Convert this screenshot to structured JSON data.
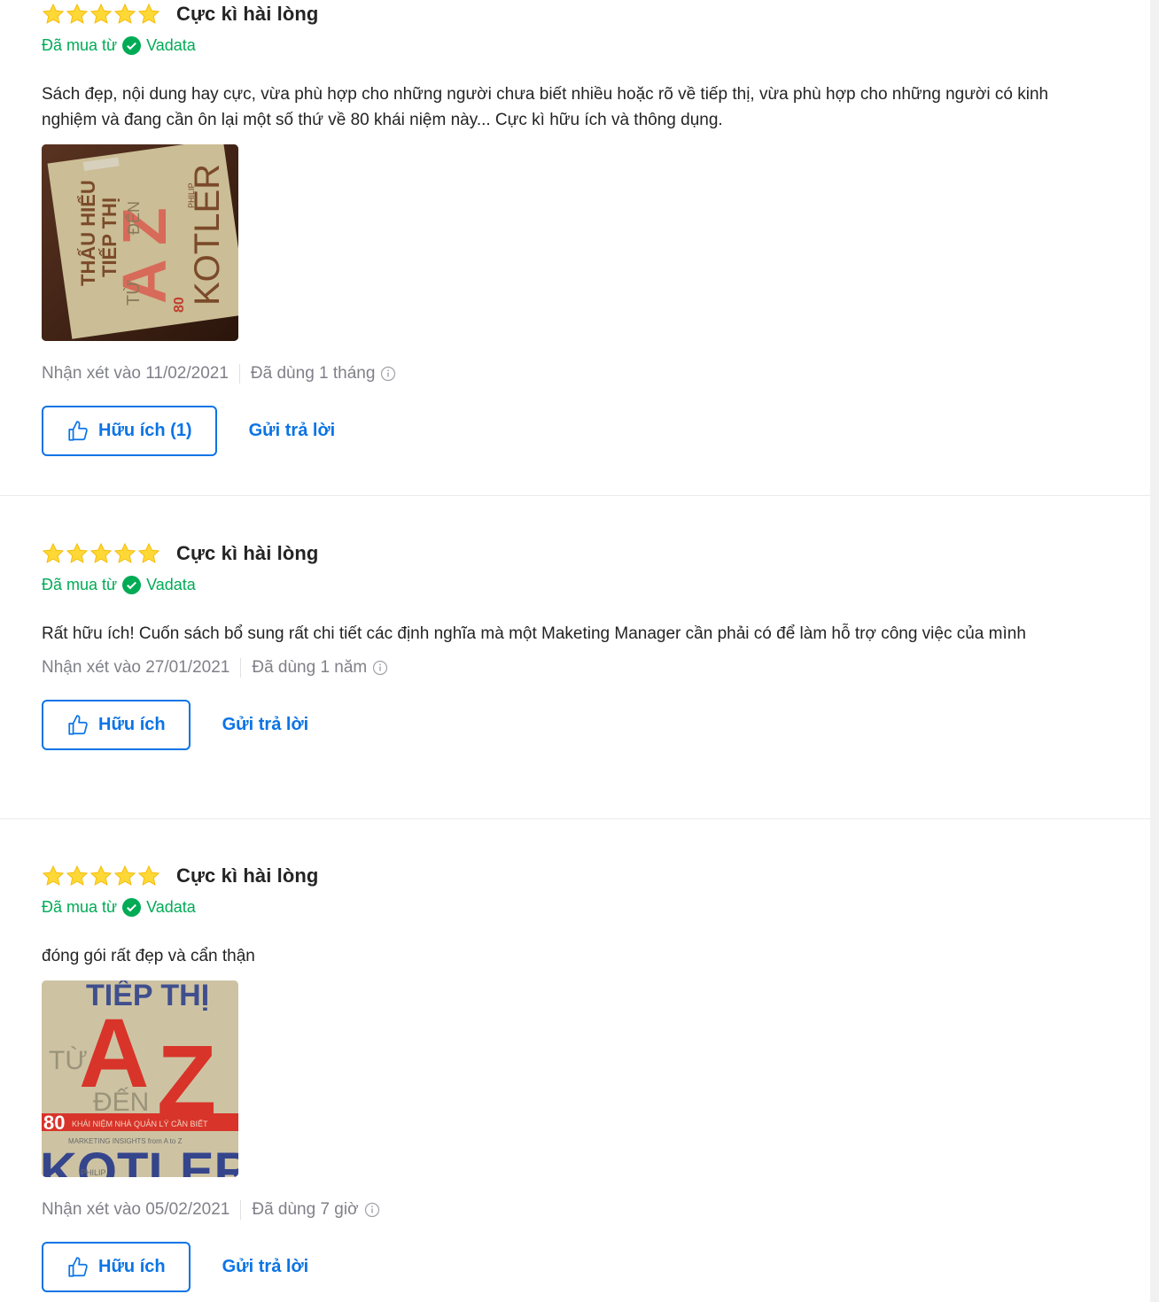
{
  "colors": {
    "star": "#fdd836",
    "seller_green": "#00ab56",
    "link_blue": "#0b74e5",
    "meta_gray": "#808089"
  },
  "reviews": [
    {
      "title": "Cực kì hài lòng",
      "rating": 5,
      "purchased_prefix": "Đã mua từ",
      "seller": "Vadata",
      "content": "Sách đẹp, nội dung hay cực, vừa phù hợp cho những người chưa biết nhiều hoặc rõ về tiếp thị, vừa phù hợp cho những người có kinh nghiệm và đang cần ôn lại một số thứ về 80 khái niệm này... Cực kì hữu ích và thông dụng.",
      "photo": {
        "line1": "THẤU HIỂU",
        "line2": "TIẾP THỊ",
        "line3": "TỪ",
        "line4": "A",
        "line5": "ĐẾN",
        "line6": "Z",
        "line7": "80",
        "line8": "KOTLER",
        "line9": "PHILIP"
      },
      "review_date": "Nhận xét vào 11/02/2021",
      "used_for": "Đã dùng 1 tháng",
      "helpful_label": "Hữu ích (1)",
      "reply_label": "Gửi trả lời"
    },
    {
      "title": "Cực kì hài lòng",
      "rating": 5,
      "purchased_prefix": "Đã mua từ",
      "seller": "Vadata",
      "content": "Rất hữu ích! Cuốn sách bổ sung rất chi tiết các định nghĩa mà một Maketing Manager cần phải có để làm hỗ trợ công việc của mình",
      "review_date": "Nhận xét vào 27/01/2021",
      "used_for": "Đã dùng 1 năm",
      "helpful_label": "Hữu ích",
      "reply_label": "Gửi trả lời"
    },
    {
      "title": "Cực kì hài lòng",
      "rating": 5,
      "purchased_prefix": "Đã mua từ",
      "seller": "Vadata",
      "content": "đóng gói rất đẹp và cẩn thận",
      "photo": {
        "line1": "TIẾP THỊ",
        "line2": "TỪ",
        "line3": "A",
        "line4": "Z",
        "line5": "ĐẾN",
        "line6": "80",
        "line7": "KHÁI NIỆM NHÀ QUẢN LÝ CẦN BIẾT",
        "line8": "MARKETING INSIGHTS from A to Z",
        "line9": "KOTLER",
        "line10": "PHILIP"
      },
      "review_date": "Nhận xét vào 05/02/2021",
      "used_for": "Đã dùng 7 giờ",
      "helpful_label": "Hữu ích",
      "reply_label": "Gửi trả lời"
    }
  ]
}
